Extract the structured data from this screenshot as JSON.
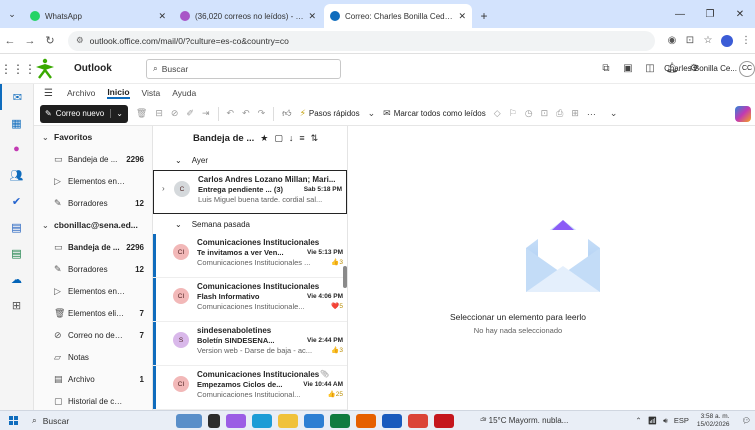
{
  "browser": {
    "tabs": [
      {
        "title": "WhatsApp",
        "color": "#25d366",
        "active": false
      },
      {
        "title": "(36,020 correos no leídos) - cha",
        "color": "#a855c7",
        "active": false
      },
      {
        "title": "Correo: Charles Bonilla Cedano",
        "color": "#0f6cbd",
        "active": true
      }
    ],
    "url": "outlook.office.com/mail/0/?culture=es-co&country=co"
  },
  "header": {
    "app_name": "Outlook",
    "search_placeholder": "Buscar",
    "user_name": "Charles Bonilla Ce...",
    "user_initials": "CC"
  },
  "ribbon": {
    "tabs": [
      "Archivo",
      "Inicio",
      "Vista",
      "Ayuda"
    ],
    "selected_tab": "Inicio",
    "new_mail": "Correo nuevo",
    "quick_steps": "Pasos rápidos",
    "mark_all_read": "Marcar todos como leídos",
    "more": "···"
  },
  "folders": {
    "favorites_label": "Favoritos",
    "favorites": [
      {
        "name": "Bandeja de ...",
        "count": "2296",
        "icon": "inbox-icon"
      },
      {
        "name": "Elementos enviados",
        "count": "",
        "icon": "send-icon"
      },
      {
        "name": "Borradores",
        "count": "12",
        "icon": "draft-icon"
      }
    ],
    "account_label": "cbonillac@sena.ed...",
    "account": [
      {
        "name": "Bandeja de ...",
        "count": "2296",
        "icon": "inbox-icon",
        "bold": true
      },
      {
        "name": "Borradores",
        "count": "12",
        "icon": "draft-icon",
        "bold": false
      },
      {
        "name": "Elementos enviados",
        "count": "",
        "icon": "send-icon",
        "bold": false
      },
      {
        "name": "Elementos elimi...",
        "count": "7",
        "icon": "trash-icon",
        "bold": false
      },
      {
        "name": "Correo no dese...",
        "count": "7",
        "icon": "junk-icon",
        "bold": false
      },
      {
        "name": "Notas",
        "count": "",
        "icon": "notes-icon",
        "bold": false
      },
      {
        "name": "Archivo",
        "count": "1",
        "icon": "archive-icon",
        "bold": false
      },
      {
        "name": "Historial de conver...",
        "count": "",
        "icon": "history-icon",
        "bold": false
      }
    ]
  },
  "message_list": {
    "title": "Bandeja de ...",
    "sections": [
      {
        "label": "Ayer",
        "messages": [
          {
            "initials": "C",
            "avatar_color": "#d5d9dc",
            "from": "Carlos Andres Lozano Millan; Mari...",
            "subject": "Entrega pendiente ... (3)",
            "date": "Sab 5:18 PM",
            "preview": "Luis Miguel buena tarde. cordial sal...",
            "badge": "",
            "selected": true,
            "unread": false,
            "thread": true,
            "attach": false
          }
        ]
      },
      {
        "label": "Semana pasada",
        "messages": [
          {
            "initials": "CI",
            "avatar_color": "#f2b8b8",
            "from": "Comunicaciones Institucionales",
            "subject": "Te invitamos a ver Ven...",
            "date": "Vie 5:13 PM",
            "preview": "Comunicaciones Institucionales ...",
            "badge": "👍3",
            "selected": false,
            "unread": true,
            "thread": false,
            "attach": false
          },
          {
            "initials": "CI",
            "avatar_color": "#f2b8b8",
            "from": "Comunicaciones Institucionales",
            "subject": "Flash Informativo",
            "date": "Vie 4:06 PM",
            "preview": "Comunicaciones Institucionale...",
            "badge": "❤️5",
            "selected": false,
            "unread": true,
            "thread": false,
            "attach": false
          },
          {
            "initials": "S",
            "avatar_color": "#d9b8ea",
            "from": "sindesenaboletines",
            "subject": "Boletín SINDESENA...",
            "date": "Vie 2:44 PM",
            "preview": "Version web - Darse de baja - ac...",
            "badge": "👍3",
            "selected": false,
            "unread": true,
            "thread": false,
            "attach": false
          },
          {
            "initials": "CI",
            "avatar_color": "#f2b8b8",
            "from": "Comunicaciones Institucionales",
            "subject": "Empezamos Ciclos de...",
            "date": "Vie 10:44 AM",
            "preview": "Comunicaciones Institucional...",
            "badge": "👍25",
            "selected": false,
            "unread": true,
            "thread": false,
            "attach": true
          }
        ]
      }
    ]
  },
  "reading_pane": {
    "title": "Seleccionar un elemento para leerlo",
    "subtitle": "No hay nada seleccionado"
  },
  "taskbar": {
    "search": "Buscar",
    "weather": "15°C  Mayorm. nubla...",
    "lang": "ESP",
    "time": "3:58 a. m.",
    "date": "15/02/2026"
  }
}
